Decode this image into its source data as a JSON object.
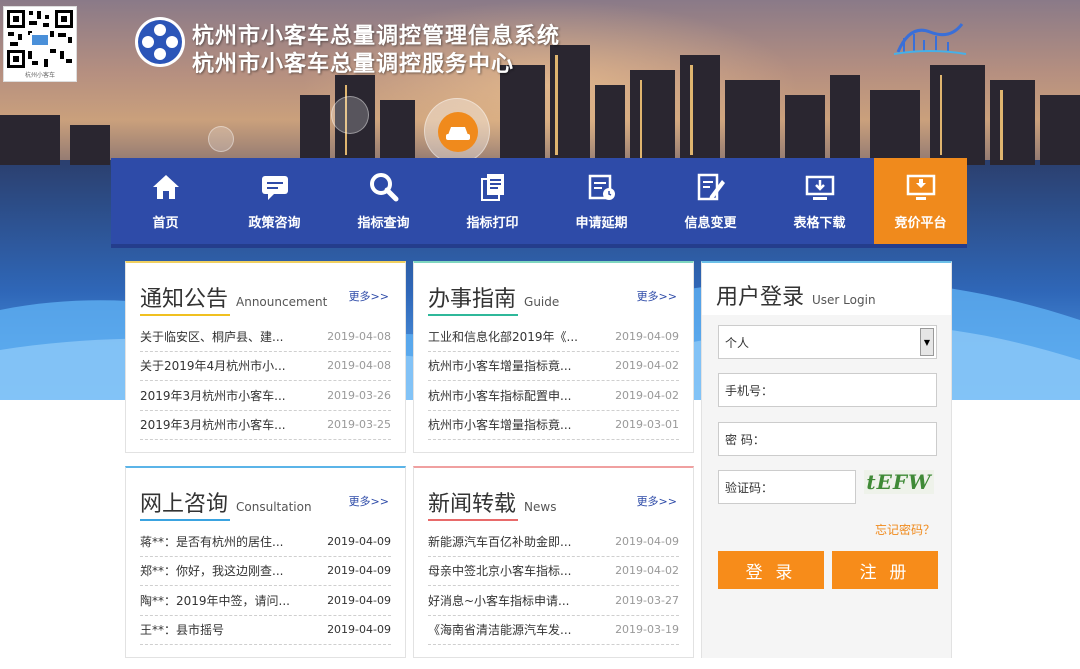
{
  "header": {
    "title_line1": "杭州市小客车总量调控管理信息系统",
    "title_line2": "杭州市小客车总量调控服务中心",
    "qr_caption": "杭州小客车"
  },
  "nav": {
    "items": [
      {
        "label": "首页",
        "icon": "home-icon"
      },
      {
        "label": "政策咨询",
        "icon": "chat-icon"
      },
      {
        "label": "指标查询",
        "icon": "search-icon"
      },
      {
        "label": "指标打印",
        "icon": "document-icon"
      },
      {
        "label": "申请延期",
        "icon": "calendar-clock-icon"
      },
      {
        "label": "信息变更",
        "icon": "edit-icon"
      },
      {
        "label": "表格下载",
        "icon": "download-icon"
      },
      {
        "label": "竞价平台",
        "icon": "monitor-icon"
      }
    ],
    "active_index": 7,
    "bg_color": "#2e4ba8",
    "active_color": "#f08a1c"
  },
  "notice": {
    "title": "通知公告",
    "title_en": "Announcement",
    "more": "更多>>",
    "items": [
      {
        "text": "关于临安区、桐庐县、建...",
        "date": "2019-04-08"
      },
      {
        "text": "关于2019年4月杭州市小...",
        "date": "2019-04-08"
      },
      {
        "text": "2019年3月杭州市小客车...",
        "date": "2019-03-26"
      },
      {
        "text": "2019年3月杭州市小客车...",
        "date": "2019-03-25"
      }
    ]
  },
  "guide": {
    "title": "办事指南",
    "title_en": "Guide",
    "more": "更多>>",
    "items": [
      {
        "text": "工业和信息化部2019年《...",
        "date": "2019-04-09"
      },
      {
        "text": "杭州市小客车增量指标竟...",
        "date": "2019-04-02"
      },
      {
        "text": "杭州市小客车指标配置申...",
        "date": "2019-04-02"
      },
      {
        "text": "杭州市小客车增量指标竟...",
        "date": "2019-03-01"
      }
    ]
  },
  "consult": {
    "title": "网上咨询",
    "title_en": "Consultation",
    "more": "更多>>",
    "items": [
      {
        "text": "蒋**：是否有杭州的居住...",
        "date": "2019-04-09"
      },
      {
        "text": "郑**：你好，我这边刚查...",
        "date": "2019-04-09"
      },
      {
        "text": "陶**：2019年中签，请问...",
        "date": "2019-04-09"
      },
      {
        "text": "王**：县市摇号",
        "date": "2019-04-09"
      }
    ]
  },
  "news": {
    "title": "新闻转载",
    "title_en": "News",
    "more": "更多>>",
    "items": [
      {
        "text": "新能源汽车百亿补助金即...",
        "date": "2019-04-09"
      },
      {
        "text": "母亲中签北京小客车指标...",
        "date": "2019-04-02"
      },
      {
        "text": "好消息~小客车指标申请...",
        "date": "2019-03-27"
      },
      {
        "text": "《海南省清洁能源汽车发...",
        "date": "2019-03-19"
      }
    ]
  },
  "login": {
    "title": "用户登录",
    "title_en": "User Login",
    "user_type": "个人",
    "phone_label": "手机号：",
    "password_label": "密 码：",
    "captcha_label": "验证码：",
    "captcha_text": "tEFW",
    "forgot": "忘记密码？",
    "login_button": "登 录",
    "register_button": "注 册"
  }
}
